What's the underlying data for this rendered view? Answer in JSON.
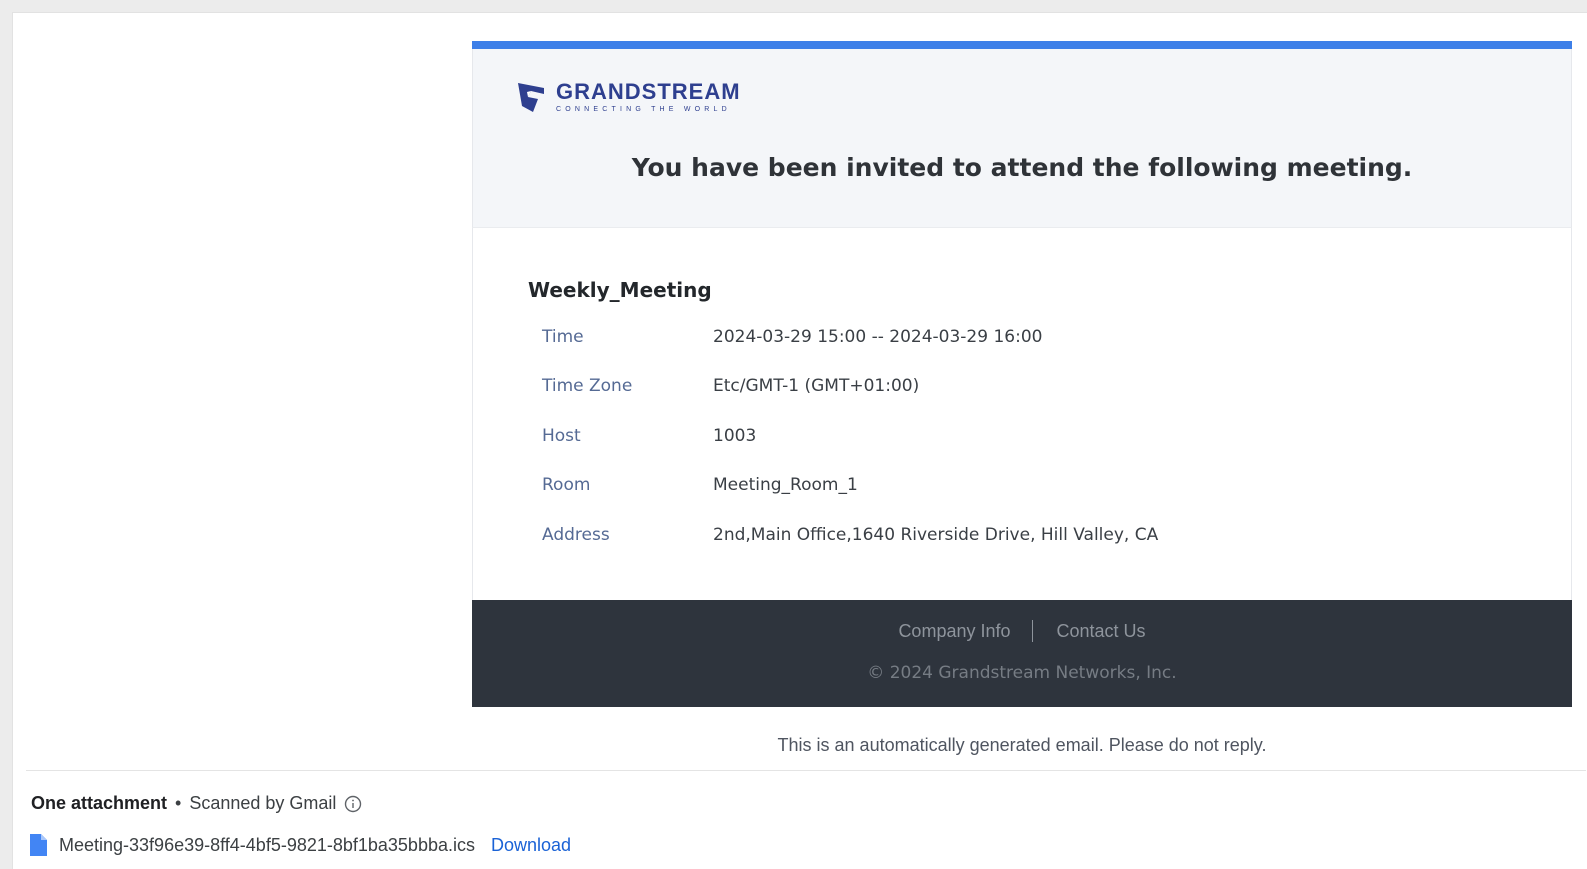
{
  "logo": {
    "name": "GRANDSTREAM",
    "tagline": "CONNECTING THE WORLD",
    "color": "#2e3f8f"
  },
  "header": {
    "title": "You have been invited to attend the following meeting.",
    "accent_color": "#3d7fe8"
  },
  "meeting": {
    "name": "Weekly_Meeting",
    "details": [
      {
        "label": "Time",
        "value": "2024-03-29 15:00 -- 2024-03-29 16:00"
      },
      {
        "label": "Time Zone",
        "value": "Etc/GMT-1 (GMT+01:00)"
      },
      {
        "label": "Host",
        "value": "1003"
      },
      {
        "label": "Room",
        "value": "Meeting_Room_1"
      },
      {
        "label": "Address",
        "value": "2nd,Main Office,1640 Riverside Drive, Hill Valley, CA"
      }
    ]
  },
  "footer": {
    "company_info": "Company Info",
    "contact_us": "Contact Us",
    "copyright": "© 2024 Grandstream Networks, Inc.",
    "background": "#2e343d"
  },
  "auto_note": "This is an automatically generated email. Please do not reply.",
  "attachments": {
    "count_label": "One attachment",
    "scan_label": "Scanned by Gmail",
    "icon": "info-icon",
    "file": {
      "name": "Meeting-33f96e39-8ff4-4bf5-9821-8bf1ba35bbba.ics",
      "icon": "file-icon",
      "download_label": "Download"
    }
  }
}
